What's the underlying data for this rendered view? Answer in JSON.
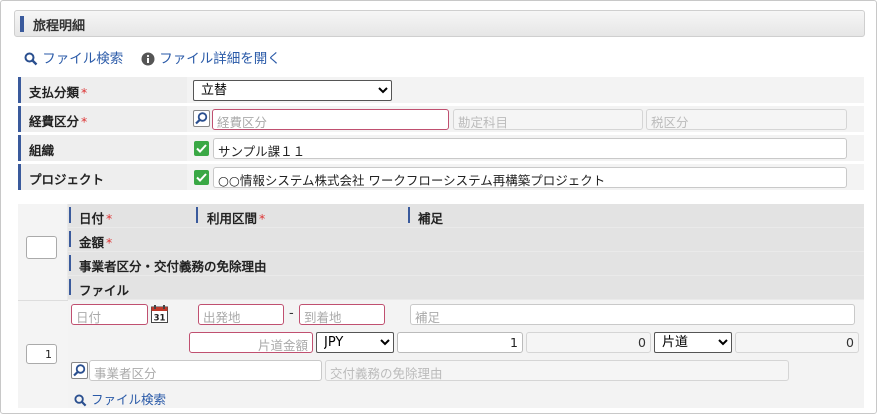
{
  "section_title": "旅程明細",
  "links": {
    "file_search": "ファイル検索",
    "file_detail": "ファイル詳細を開く"
  },
  "form": {
    "payment_type": {
      "label": "支払分類",
      "required": "*",
      "selected": "立替"
    },
    "expense_category": {
      "label": "経費区分",
      "required": "*",
      "placeholder": "経費区分",
      "account_placeholder": "勘定科目",
      "tax_placeholder": "税区分"
    },
    "organization": {
      "label": "組織",
      "value": "サンプル課１１"
    },
    "project": {
      "label": "プロジェクト",
      "value": "○○情報システム株式会社 ワークフローシステム再構築プロジェクト"
    }
  },
  "grid": {
    "headers": {
      "date": "日付",
      "route": "利用区間",
      "note": "補足",
      "amount": "金額",
      "business_category": "事業者区分・交付義務の免除理由",
      "file": "ファイル",
      "required": "*"
    },
    "row": {
      "number": "1",
      "date_placeholder": "日付",
      "calendar_day": "31",
      "departure_placeholder": "出発地",
      "route_separator": "-",
      "arrival_placeholder": "到着地",
      "note_placeholder": "補足",
      "one_way_placeholder": "片道金額",
      "currency": "JPY",
      "rate": "1",
      "amount": "0",
      "trip_type": "片道",
      "total": "0",
      "business_placeholder": "事業者区分",
      "exemption_placeholder": "交付義務の免除理由",
      "file_search": "ファイル検索"
    }
  },
  "colors": {
    "accent": "#3a5a9c",
    "link": "#2a5aa8",
    "required": "#dd3333",
    "check": "#3aa845"
  }
}
